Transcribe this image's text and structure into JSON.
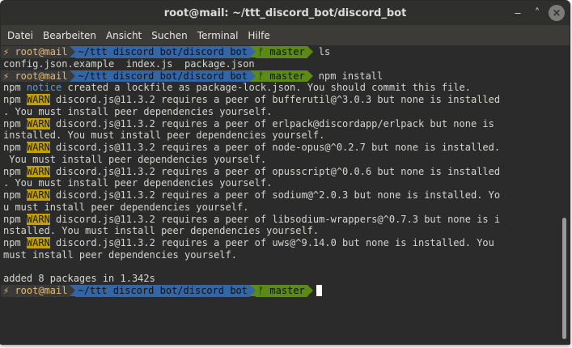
{
  "window": {
    "title": "root@mail: ~/ttt_discord_bot/discord_bot"
  },
  "menu": [
    "Datei",
    "Bearbeiten",
    "Ansicht",
    "Suchen",
    "Terminal",
    "Hilfe"
  ],
  "prompt": {
    "user": "⚡ root@mail",
    "path": "~/ttt discord bot/discord bot",
    "branch": "ᚠ master"
  },
  "commands": {
    "c1": "ls",
    "c2": "npm install"
  },
  "ls_output": "config.json.example  index.js  package.json",
  "npm": {
    "prefix": "npm ",
    "notice_tag": "notice",
    "notice_text": " created a lockfile as package-lock.json. You should commit this file.",
    "warn_tag": "WARN",
    "warnings": [
      {
        "line1": " discord.js@11.3.2 requires a peer of bufferutil@^3.0.3 but none is installed",
        "line2": ". You must install peer dependencies yourself."
      },
      {
        "line1": " discord.js@11.3.2 requires a peer of erlpack@discordapp/erlpack but none is",
        "line2": "installed. You must install peer dependencies yourself."
      },
      {
        "line1": " discord.js@11.3.2 requires a peer of node-opus@^0.2.7 but none is installed.",
        "line2": " You must install peer dependencies yourself."
      },
      {
        "line1": " discord.js@11.3.2 requires a peer of opusscript@^0.0.6 but none is installed",
        "line2": ". You must install peer dependencies yourself."
      },
      {
        "line1": " discord.js@11.3.2 requires a peer of sodium@^2.0.3 but none is installed. Yo",
        "line2": "u must install peer dependencies yourself."
      },
      {
        "line1": " discord.js@11.3.2 requires a peer of libsodium-wrappers@^0.7.3 but none is i",
        "line2": "nstalled. You must install peer dependencies yourself."
      },
      {
        "line1": " discord.js@11.3.2 requires a peer of uws@^9.14.0 but none is installed. You",
        "line2": "must install peer dependencies yourself."
      }
    ],
    "summary": "added 8 packages in 1.342s"
  },
  "colors": {
    "terminal_bg": "#2b2b2b",
    "path_segment": "#3465a4",
    "git_segment": "#5c8a16",
    "warn_badge": "#c4a000",
    "notice": "#5c9ad6"
  },
  "icons": {
    "minimize": "minimize-icon",
    "maximize": "maximize-icon",
    "close": "close-icon"
  }
}
